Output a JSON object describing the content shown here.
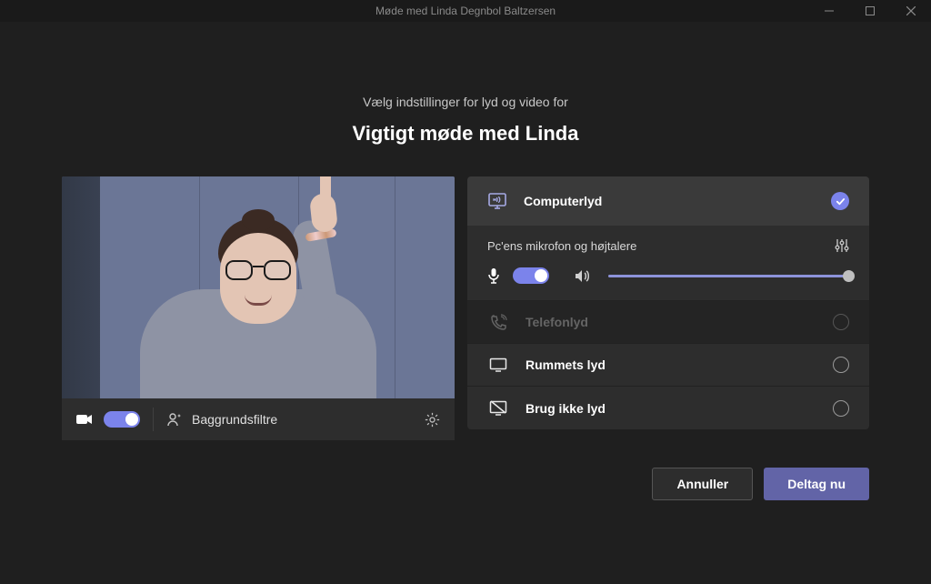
{
  "window": {
    "title": "Møde med Linda Degnbol Baltzersen"
  },
  "header": {
    "subtitle": "Vælg indstillinger for lyd og video for",
    "title": "Vigtigt møde med Linda"
  },
  "video": {
    "bg_filters_label": "Baggrundsfiltre",
    "camera_on": true
  },
  "audio": {
    "computer": {
      "label": "Computerlyd",
      "device_label": "Pc'ens mikrofon og højtalere",
      "selected": true,
      "mic_on": true
    },
    "phone": {
      "label": "Telefonlyd"
    },
    "room": {
      "label": "Rummets lyd"
    },
    "none": {
      "label": "Brug ikke lyd"
    }
  },
  "footer": {
    "cancel": "Annuller",
    "join": "Deltag nu"
  }
}
